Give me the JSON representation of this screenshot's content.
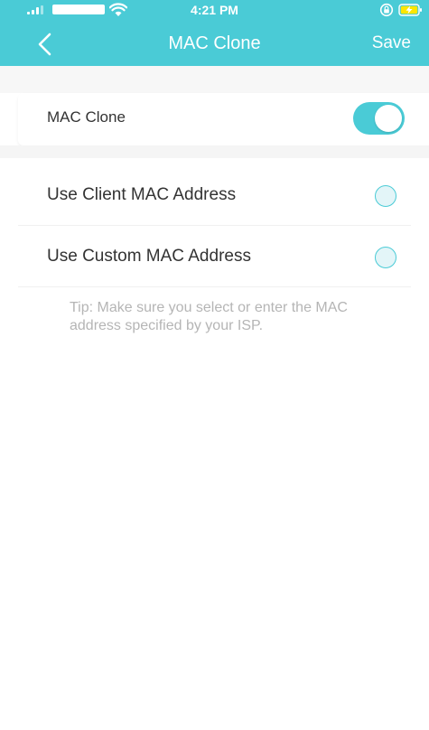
{
  "status_bar": {
    "time": "4:21 PM"
  },
  "nav": {
    "title": "MAC Clone",
    "save_label": "Save"
  },
  "toggle": {
    "label": "MAC Clone",
    "enabled": true
  },
  "options": [
    {
      "label": "Use Client MAC Address",
      "selected": false
    },
    {
      "label": "Use Custom MAC Address",
      "selected": false
    }
  ],
  "tip": "Tip: Make sure you select or enter the MAC address specified by your ISP.",
  "colors": {
    "accent": "#4acbd6",
    "text": "#333333",
    "tip": "#b5b5b5",
    "background": "#ffffff"
  }
}
